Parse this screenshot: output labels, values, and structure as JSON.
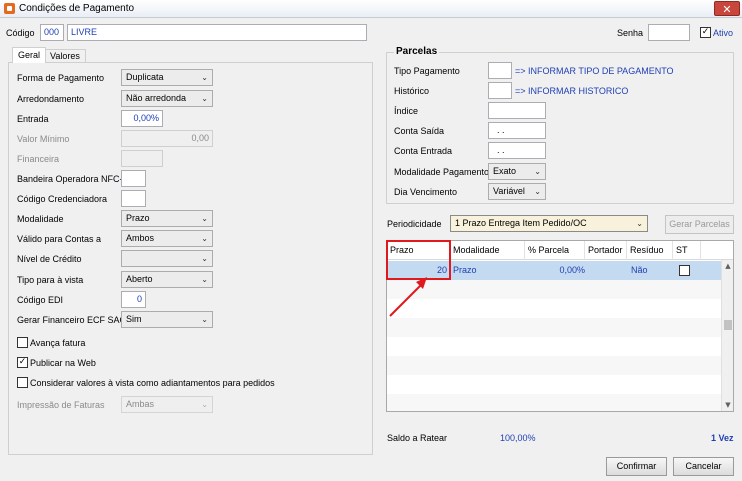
{
  "window": {
    "title": "Condições de Pagamento",
    "close_glyph": "✕"
  },
  "header": {
    "codigo_label": "Código",
    "codigo_value": "000",
    "descricao_value": "LIVRE",
    "senha_label": "Senha",
    "senha_value": "",
    "ativo_label": "Ativo",
    "ativo_checked": true
  },
  "tabs": [
    {
      "label": "Geral",
      "active": true
    },
    {
      "label": "Valores",
      "active": false
    }
  ],
  "geral": {
    "forma_pagamento": {
      "label": "Forma de Pagamento",
      "value": "Duplicata"
    },
    "arredondamento": {
      "label": "Arredondamento",
      "value": "Não arredonda"
    },
    "entrada": {
      "label": "Entrada",
      "value": "0,00%"
    },
    "valor_minimo": {
      "label": "Valor Mínimo",
      "value": "0,00"
    },
    "financeira": {
      "label": "Financeira",
      "value": ""
    },
    "bandeira": {
      "label": "Bandeira Operadora NFC-e",
      "value": ""
    },
    "credenciadora": {
      "label": "Código Credenciadora",
      "value": ""
    },
    "modalidade": {
      "label": "Modalidade",
      "value": "Prazo"
    },
    "valido_contas": {
      "label": "Válido para Contas a",
      "value": "Ambos"
    },
    "nivel_credito": {
      "label": "Nível de Crédito",
      "value": ""
    },
    "tipo_vista": {
      "label": "Tipo para à vista",
      "value": "Aberto"
    },
    "codigo_edi": {
      "label": "Código EDI",
      "value": "0"
    },
    "gerar_financeiro": {
      "label": "Gerar Financeiro ECF SAC",
      "value": "Sim"
    },
    "avanca_fatura": {
      "label": "Avança fatura",
      "checked": false
    },
    "publicar_web": {
      "label": "Publicar na Web",
      "checked": true
    },
    "considerar_valores": {
      "label": "Considerar valores à vista como adiantamentos para pedidos",
      "checked": false
    },
    "impressao_faturas": {
      "label": "Impressão de Faturas",
      "value": "Ambas"
    }
  },
  "parcelas": {
    "title": "Parcelas",
    "tipo_pagamento": {
      "label": "Tipo Pagamento",
      "value": "",
      "hint": "=> INFORMAR TIPO DE PAGAMENTO"
    },
    "historico": {
      "label": "Histórico",
      "value": "",
      "hint": "=> INFORMAR HISTORICO"
    },
    "indice": {
      "label": "Índice",
      "value": ""
    },
    "conta_saida": {
      "label": "Conta Saída",
      "value": ". ."
    },
    "conta_entrada": {
      "label": "Conta Entrada",
      "value": ". ."
    },
    "modalidade_pagamento": {
      "label": "Modalidade Pagamento",
      "value": "Exato"
    },
    "dia_vencimento": {
      "label": "Dia Vencimento",
      "value": "Variável"
    }
  },
  "periodicidade": {
    "label": "Periodicidade",
    "value": "1 Prazo Entrega Item Pedido/OC",
    "gerar_button": "Gerar Parcelas"
  },
  "grid": {
    "columns": [
      "Prazo",
      "Modalidade",
      "% Parcela",
      "Portador",
      "Resíduo",
      "ST"
    ],
    "rows": [
      {
        "prazo": "20",
        "modalidade": "Prazo",
        "parcela": "0,00%",
        "portador": "",
        "residuo": "Não",
        "st": false
      }
    ]
  },
  "footer": {
    "saldo_label": "Saldo a Ratear",
    "saldo_value": "100,00%",
    "vezes": "1 Vez",
    "confirmar": "Confirmar",
    "cancelar": "Cancelar"
  },
  "colors": {
    "accent_blue": "#1f3fb5",
    "highlight_red": "#e0191e",
    "row_selected": "#c4daf0"
  },
  "icons": {
    "dropdown": "chevron-down-icon",
    "close": "close-icon",
    "check": "checkmark-icon"
  }
}
